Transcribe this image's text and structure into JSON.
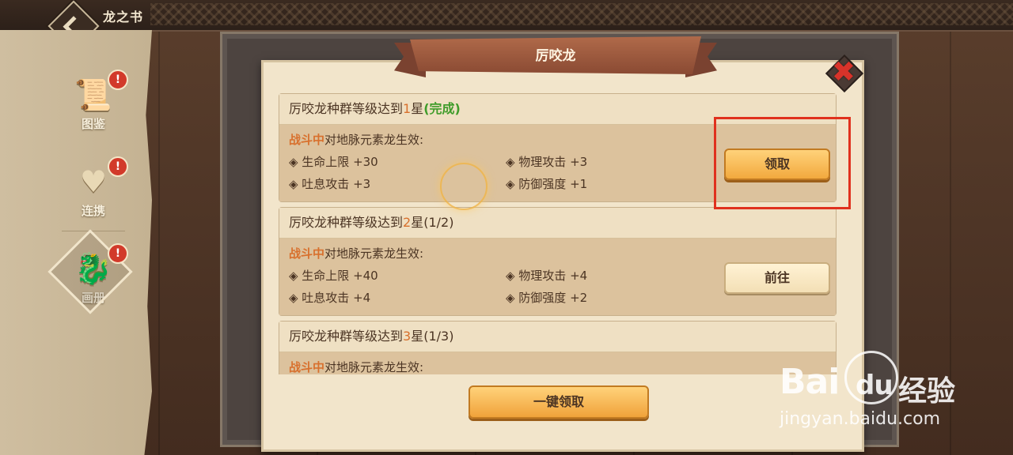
{
  "app": {
    "title": "龙之书"
  },
  "sidebar": {
    "items": [
      {
        "label": "图鉴",
        "icon": "scroll-icon",
        "badge": "!"
      },
      {
        "label": "连携",
        "icon": "link-icon",
        "badge": "!"
      },
      {
        "label": "画册",
        "icon": "album-icon",
        "badge": "!"
      }
    ]
  },
  "dialog": {
    "title": "厉咬龙",
    "close_icon": "close-icon",
    "tasks": [
      {
        "title_prefix": "厉咬龙种群等级达到",
        "star_num": "1",
        "title_suffix": "星",
        "progress": "(完成)",
        "cond_highlight": "战斗中",
        "cond_text": "对地脉元素龙生效:",
        "stats": [
          "◈ 生命上限 +30",
          "◈ 物理攻击 +3",
          "◈ 吐息攻击 +3",
          "◈ 防御强度 +1"
        ],
        "button": "领取"
      },
      {
        "title_prefix": "厉咬龙种群等级达到",
        "star_num": "2",
        "title_suffix": "星",
        "progress": "(1/2)",
        "cond_highlight": "战斗中",
        "cond_text": "对地脉元素龙生效:",
        "stats": [
          "◈ 生命上限 +40",
          "◈ 物理攻击 +4",
          "◈ 吐息攻击 +4",
          "◈ 防御强度 +2"
        ],
        "button": "前往"
      },
      {
        "title_prefix": "厉咬龙种群等级达到",
        "star_num": "3",
        "title_suffix": "星",
        "progress": "(1/3)",
        "cond_highlight": "战斗中",
        "cond_text": "对地脉元素龙生效:"
      }
    ],
    "claim_all": "一键领取"
  },
  "watermark": {
    "logo": "Bai",
    "logo2": "du",
    "side": "经验",
    "url": "jingyan.baidu.com"
  },
  "colors": {
    "accent_orange": "#d8702d",
    "done_green": "#3f9c2a",
    "highlight_red": "#e0311e"
  }
}
